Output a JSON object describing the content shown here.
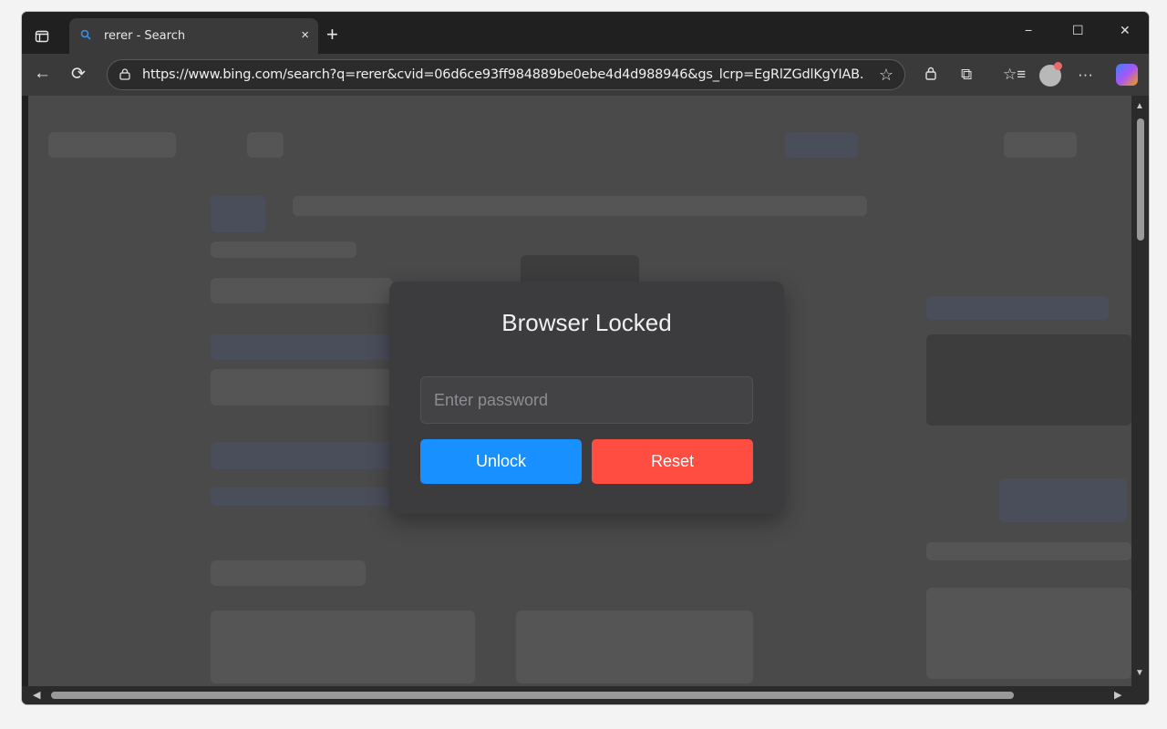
{
  "browser": {
    "tab": {
      "title": "rerer - Search",
      "favicon": "search-icon"
    },
    "address": {
      "url": "https://www.bing.com/search?q=rerer&cvid=06d6ce93ff984889be0ebe4d4d988946&gs_lcrp=EgRlZGdlKgYIAB..."
    },
    "icons": {
      "tab_actions": "tab-actions-icon",
      "close_tab": "×",
      "new_tab": "+",
      "minimize": "−",
      "maximize": "☐",
      "close_window": "✕",
      "back": "←",
      "refresh": "⟳",
      "lock": "🔒︎",
      "favorite": "☆",
      "lock_ext": "🔒︎",
      "extensions": "⧉",
      "favorites": "☆≡",
      "more": "···"
    }
  },
  "modal": {
    "title": "Browser Locked",
    "password_placeholder": "Enter password",
    "unlock_label": "Unlock",
    "reset_label": "Reset"
  },
  "colors": {
    "unlock": "#1890ff",
    "reset": "#ff4d42",
    "modal_bg": "#3c3c3e"
  }
}
